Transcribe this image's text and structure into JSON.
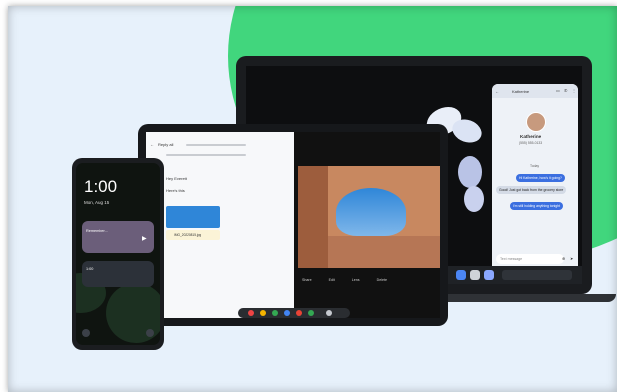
{
  "phone": {
    "time": "1:00",
    "date": "Mon, Aug 15",
    "notification_title": "Remember...",
    "notification_time": "1:00"
  },
  "tablet": {
    "email_subject": "Reply all",
    "email_line1": "Hey Everett",
    "email_line2": "Here's this",
    "attachment_name": "IMG_20220815.jpg",
    "photo_actions": [
      "Share",
      "Edit",
      "Lens",
      "Delete"
    ]
  },
  "laptop": {
    "contact_name": "Katherine",
    "contact_sub": "(555) 555-0133",
    "day_label": "Today",
    "messages": [
      {
        "from": "me",
        "text": "Hi Katherine, how's it going?"
      },
      {
        "from": "them",
        "text": "Good! Just got back from the grocery store"
      },
      {
        "from": "me",
        "text": "I'm still holding anything tonight"
      }
    ],
    "input_placeholder": "Text message"
  },
  "colors": {
    "background": "#e7f1fb",
    "accent_green": "#41d67d",
    "message_blue": "#3b6fe0"
  }
}
